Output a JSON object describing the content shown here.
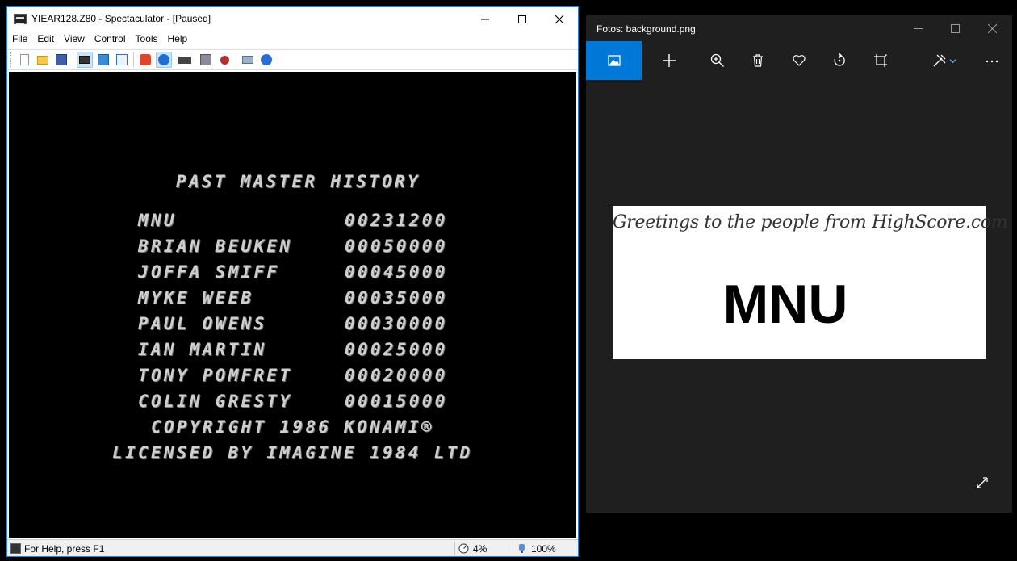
{
  "spectaculator": {
    "title": "YIEAR128.Z80 - Spectaculator - [Paused]",
    "menu": [
      "File",
      "Edit",
      "View",
      "Control",
      "Tools",
      "Help"
    ],
    "toolbar_icons": [
      "new-file-icon",
      "open-folder-icon",
      "save-disk-icon",
      "keyboard-view-icon",
      "window-mode-icon",
      "screen-layout-icon",
      "reset-icon",
      "pause-icon",
      "joystick-icon",
      "tape-icon",
      "record-icon",
      "printer-icon",
      "help-icon"
    ],
    "screen": {
      "heading": "PAST MASTER HISTORY",
      "scores": [
        {
          "name": "MNU",
          "score": "00231200"
        },
        {
          "name": "BRIAN BEUKEN",
          "score": "00050000"
        },
        {
          "name": "JOFFA SMIFF",
          "score": "00045000"
        },
        {
          "name": "MYKE WEEB",
          "score": "00035000"
        },
        {
          "name": "PAUL OWENS",
          "score": "00030000"
        },
        {
          "name": "IAN MARTIN",
          "score": "00025000"
        },
        {
          "name": "TONY POMFRET",
          "score": "00020000"
        },
        {
          "name": "COLIN GRESTY",
          "score": "00015000"
        }
      ],
      "copyright": "COPYRIGHT 1986 KONAMI®",
      "license": "LICENSED BY IMAGINE 1984 LTD"
    },
    "status": {
      "help_text": "For Help, press F1",
      "speed": "4%",
      "volume": "100%"
    }
  },
  "photos": {
    "title": "Fotos: background.png",
    "image": {
      "greeting": "Greetings to the people from HighScore.com",
      "big_text": "MNU"
    }
  }
}
